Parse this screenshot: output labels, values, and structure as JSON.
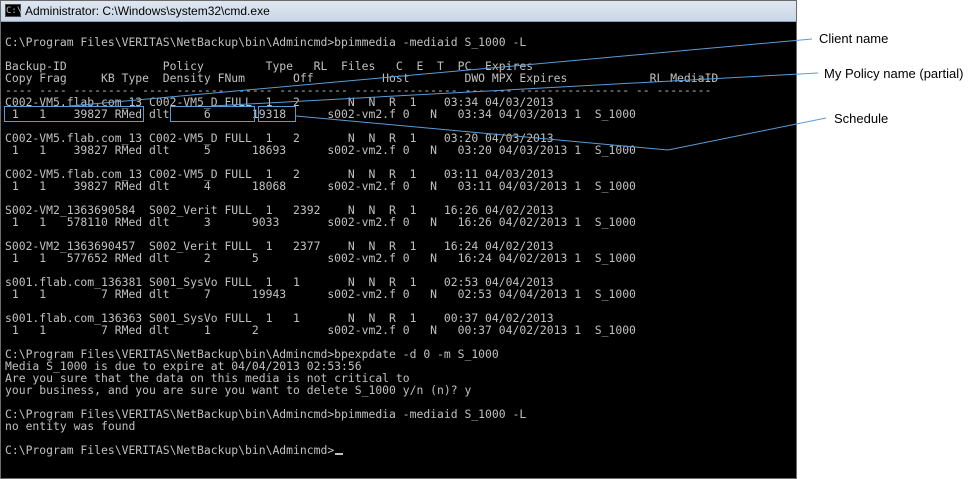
{
  "window": {
    "title": "Administrator: C:\\Windows\\system32\\cmd.exe",
    "icon": "cmd-icon"
  },
  "console_lines": [
    "",
    "C:\\Program Files\\VERITAS\\NetBackup\\bin\\Admincmd>bpimmedia -mediaid S_1000 -L",
    "",
    "Backup-ID              Policy         Type   RL  Files   C  E  T  PC  Expires",
    "Copy Frag     KB Type  Density FNum       Off          Host        DWO MPX Expires            RL MediaID",
    "---- ---- --------- ---- ------- ------ ---------- --------------- --- --- ---------------- -- --------",
    "C002-VM5.flab.com_13 C002-VM5_D FULL  1   2       N  N  R  1    03:34 04/03/2013",
    " 1   1    39827 RMed dlt     6      19318      s002-vm2.f 0   N   03:34 04/03/2013 1  S_1000",
    "",
    "C002-VM5.flab.com_13 C002-VM5_D FULL  1   2       N  N  R  1    03:20 04/03/2013",
    " 1   1    39827 RMed dlt     5      18693      s002-vm2.f 0   N   03:20 04/03/2013 1  S_1000",
    "",
    "C002-VM5.flab.com_13 C002-VM5_D FULL  1   2       N  N  R  1    03:11 04/03/2013",
    " 1   1    39827 RMed dlt     4      18068      s002-vm2.f 0   N   03:11 04/03/2013 1  S_1000",
    "",
    "S002-VM2_1363690584  S002_Verit FULL  1   2392    N  N  R  1    16:26 04/02/2013",
    " 1   1   578110 RMed dlt     3      9033       s002-vm2.f 0   N   16:26 04/02/2013 1  S_1000",
    "",
    "S002-VM2_1363690457  S002_Verit FULL  1   2377    N  N  R  1    16:24 04/02/2013",
    " 1   1   577652 RMed dlt     2      5          s002-vm2.f 0   N   16:24 04/02/2013 1  S_1000",
    "",
    "s001.flab.com_136381 S001_SysVo FULL  1   1       N  N  R  1    02:53 04/04/2013",
    " 1   1        7 RMed dlt     7      19943      s002-vm2.f 0   N   02:53 04/04/2013 1  S_1000",
    "",
    "s001.flab.com_136363 S001_SysVo FULL  1   1       N  N  R  1    00:37 04/02/2013",
    " 1   1        7 RMed dlt     1      2          s002-vm2.f 0   N   00:37 04/02/2013 1  S_1000",
    "",
    "C:\\Program Files\\VERITAS\\NetBackup\\bin\\Admincmd>bpexpdate -d 0 -m S_1000",
    "Media S_1000 is due to expire at 04/04/2013 02:53:56",
    "Are you sure that the data on this media is not critical to",
    "your business, and you are sure you want to delete S_1000 y/n (n)? y",
    "",
    "C:\\Program Files\\VERITAS\\NetBackup\\bin\\Admincmd>bpimmedia -mediaid S_1000 -L",
    "no entity was found",
    "",
    "C:\\Program Files\\VERITAS\\NetBackup\\bin\\Admincmd>"
  ],
  "annotations": {
    "client_name": "Client name",
    "policy_name": "My Policy name (partial)",
    "schedule": "Schedule"
  },
  "colors": {
    "console_bg": "#000000",
    "console_text": "#c0c0c0",
    "highlight": "#5b9bd5"
  }
}
